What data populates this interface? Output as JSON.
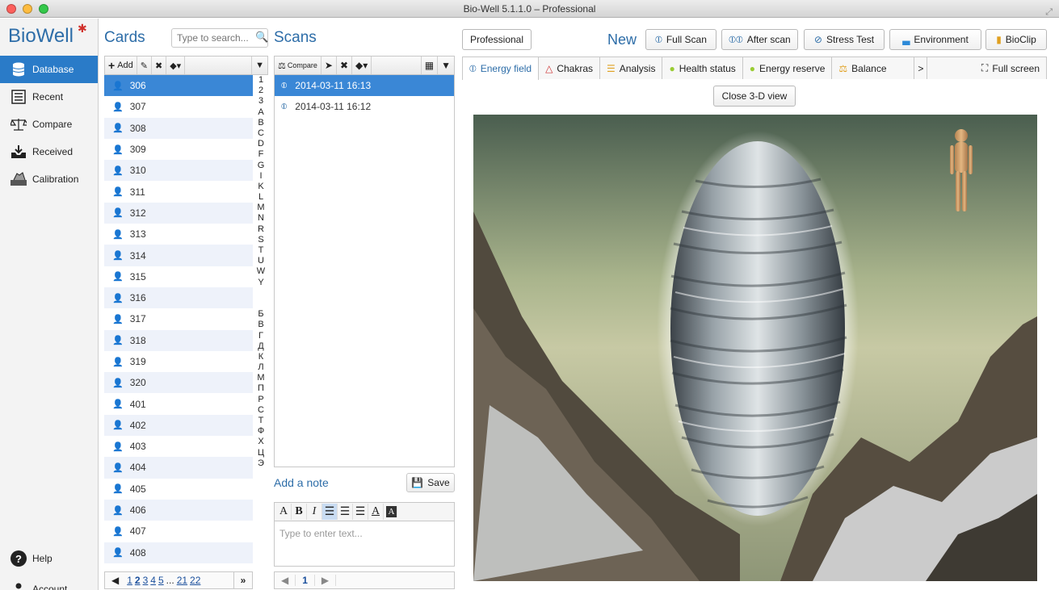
{
  "window": {
    "title": "Bio-Well 5.1.1.0 – Professional"
  },
  "sidebar": {
    "logo": "BioWell",
    "items": [
      {
        "label": "Database",
        "icon": "database-icon"
      },
      {
        "label": "Recent",
        "icon": "list-icon"
      },
      {
        "label": "Compare",
        "icon": "scales-icon"
      },
      {
        "label": "Received",
        "icon": "inbox-icon"
      },
      {
        "label": "Calibration",
        "icon": "calibration-icon"
      }
    ],
    "help": "Help",
    "account": "Account"
  },
  "cards": {
    "title": "Cards",
    "search_placeholder": "Type to search...",
    "add_label": "Add",
    "items": [
      "306",
      "307",
      "308",
      "309",
      "310",
      "311",
      "312",
      "313",
      "314",
      "315",
      "316",
      "317",
      "318",
      "319",
      "320",
      "401",
      "402",
      "403",
      "404",
      "405",
      "406",
      "407",
      "408"
    ],
    "selected": "306",
    "alphabet": [
      "1",
      "2",
      "3",
      "A",
      "B",
      "C",
      "D",
      "F",
      "G",
      "I",
      "K",
      "L",
      "M",
      "N",
      "R",
      "S",
      "T",
      "U",
      "W",
      "Y",
      "",
      "",
      "Б",
      "В",
      "Г",
      "Д",
      "К",
      "Л",
      "М",
      "П",
      "Р",
      "С",
      "Т",
      "Ф",
      "Х",
      "Ц",
      "Э"
    ],
    "pager": {
      "pages": [
        "1",
        "2",
        "3",
        "4",
        "5"
      ],
      "ellipsis": "...",
      "more": [
        "21",
        "22"
      ],
      "current": "2"
    }
  },
  "scans": {
    "title": "Scans",
    "compare_label": "Compare",
    "items": [
      "2014-03-11 16:13",
      "2014-03-11 16:12"
    ],
    "selected": "2014-03-11 16:13",
    "add_note": "Add a note",
    "save_label": "Save",
    "note_placeholder": "Type to enter text...",
    "page": "1"
  },
  "main": {
    "mode_button": "Professional",
    "new_label": "New",
    "actions": [
      {
        "label": "Full Scan",
        "icon": "fingerprint-icon"
      },
      {
        "label": "After scan",
        "icon": "fingerprints-icon"
      },
      {
        "label": "Stress Test",
        "icon": "stress-icon"
      },
      {
        "label": "Environment",
        "icon": "environment-icon"
      },
      {
        "label": "BioClip",
        "icon": "bar-chart-icon"
      }
    ],
    "tabs": [
      {
        "label": "Energy field",
        "icon": "fingerprint-icon"
      },
      {
        "label": "Chakras",
        "icon": "triangle-icon"
      },
      {
        "label": "Analysis",
        "icon": "bars-icon"
      },
      {
        "label": "Health status",
        "icon": "dot-icon"
      },
      {
        "label": "Energy reserve",
        "icon": "dot-icon"
      },
      {
        "label": "Balance",
        "icon": "scales-icon"
      }
    ],
    "active_tab": "Energy field",
    "fullscreen_label": "Full screen",
    "close_3d": "Close 3-D view"
  },
  "colors": {
    "accent": "#2d6da8",
    "selection": "#3a87d6",
    "nav_active": "#2a7bc8"
  }
}
